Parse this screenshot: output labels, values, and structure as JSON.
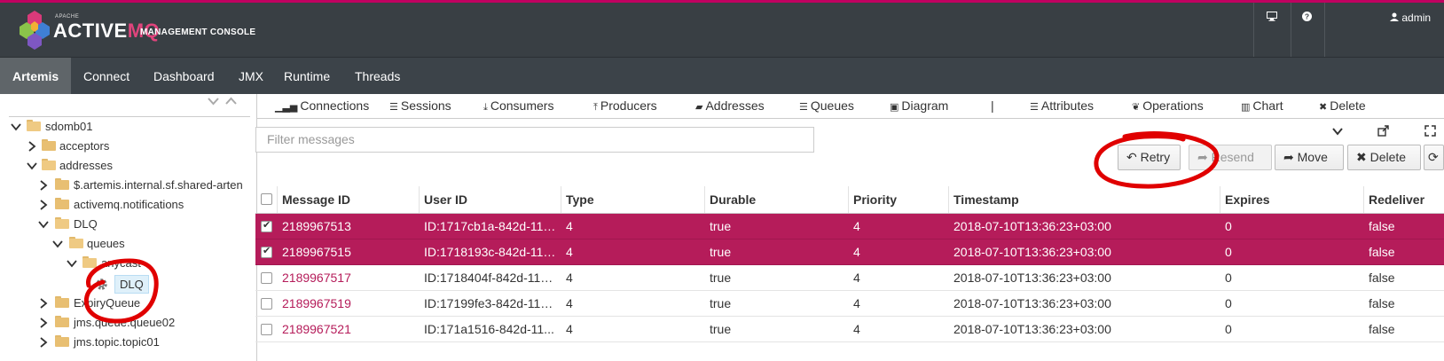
{
  "header": {
    "brand_small": "APACHE",
    "brand_name": "ACTIVE",
    "brand_mq": "MQ",
    "brand_console": "MANAGEMENT CONSOLE",
    "monitor_icon": "monitor-icon",
    "help_icon": "question-icon",
    "user_label": "admin"
  },
  "nav": {
    "items": [
      "Artemis",
      "Connect",
      "Dashboard",
      "JMX",
      "Runtime",
      "Threads"
    ],
    "active": "Artemis"
  },
  "sidebar": {
    "tree": [
      {
        "label": "sdomb01"
      },
      {
        "label": "acceptors"
      },
      {
        "label": "addresses"
      },
      {
        "label": "$.artemis.internal.sf.shared-arten"
      },
      {
        "label": "activemq.notifications"
      },
      {
        "label": "DLQ"
      },
      {
        "label": "queues"
      },
      {
        "label": "anycast"
      },
      {
        "label": "DLQ"
      },
      {
        "label": "ExpiryQueue"
      },
      {
        "label": "jms.queue.queue02"
      },
      {
        "label": "jms.topic.topic01"
      }
    ]
  },
  "tabs": [
    {
      "icon": "signal-icon",
      "label": "Connections"
    },
    {
      "icon": "list-icon",
      "label": "Sessions"
    },
    {
      "icon": "download-icon",
      "label": "Consumers"
    },
    {
      "icon": "upload-icon",
      "label": "Producers"
    },
    {
      "icon": "book-icon",
      "label": "Addresses"
    },
    {
      "icon": "list-icon",
      "label": "Queues"
    },
    {
      "icon": "image-icon",
      "label": "Diagram"
    },
    {
      "icon": "separator",
      "label": "|"
    },
    {
      "icon": "list-icon",
      "label": "Attributes"
    },
    {
      "icon": "leaf-icon",
      "label": "Operations"
    },
    {
      "icon": "chart-icon",
      "label": "Chart"
    },
    {
      "icon": "times-icon",
      "label": "Delete"
    }
  ],
  "filter": {
    "placeholder": "Filter messages"
  },
  "actions": {
    "retry": "Retry",
    "resend": "Resend",
    "move": "Move",
    "delete": "Delete"
  },
  "table": {
    "columns": [
      "Message ID",
      "User ID",
      "Type",
      "Durable",
      "Priority",
      "Timestamp",
      "Expires",
      "Redeliver"
    ],
    "rows": [
      {
        "selected": true,
        "id": "2189967513",
        "user": "ID:1717cb1a-842d-11e...",
        "type": "4",
        "durable": "true",
        "priority": "4",
        "timestamp": "2018-07-10T13:36:23+03:00",
        "expires": "0",
        "redeliver": "false"
      },
      {
        "selected": true,
        "id": "2189967515",
        "user": "ID:1718193c-842d-11e...",
        "type": "4",
        "durable": "true",
        "priority": "4",
        "timestamp": "2018-07-10T13:36:23+03:00",
        "expires": "0",
        "redeliver": "false"
      },
      {
        "selected": false,
        "id": "2189967517",
        "user": "ID:1718404f-842d-11e...",
        "type": "4",
        "durable": "true",
        "priority": "4",
        "timestamp": "2018-07-10T13:36:23+03:00",
        "expires": "0",
        "redeliver": "false"
      },
      {
        "selected": false,
        "id": "2189967519",
        "user": "ID:17199fe3-842d-11e...",
        "type": "4",
        "durable": "true",
        "priority": "4",
        "timestamp": "2018-07-10T13:36:23+03:00",
        "expires": "0",
        "redeliver": "false"
      },
      {
        "selected": false,
        "id": "2189967521",
        "user": "ID:171a1516-842d-11...",
        "type": "4",
        "durable": "true",
        "priority": "4",
        "timestamp": "2018-07-10T13:36:23+03:00",
        "expires": "0",
        "redeliver": "false"
      }
    ]
  },
  "colors": {
    "accent": "#b51c5a",
    "topbar": "#393f44",
    "navbar": "#3c4349",
    "annotation": "#e00000"
  }
}
